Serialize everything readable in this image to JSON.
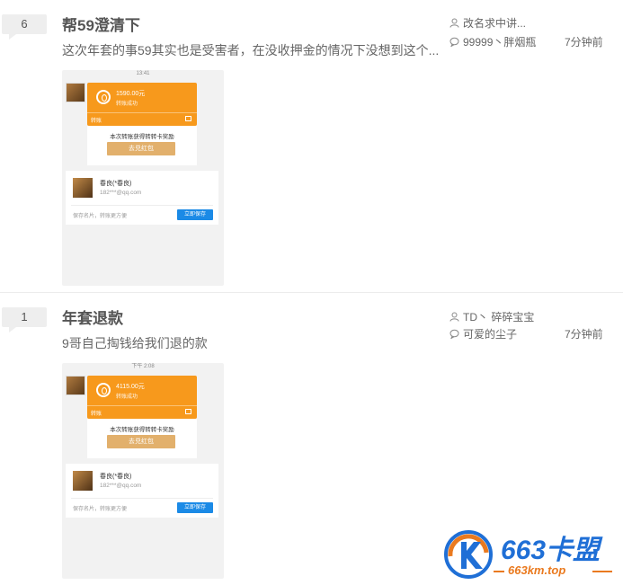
{
  "posts": [
    {
      "reply_count": "6",
      "title": "帮59澄清下",
      "excerpt": "这次年套的事59其实也是受害者，在没收押金的情况下没想到这个...",
      "author": "改名求中讲...",
      "last_reply": "99999丶胖烟瓶",
      "time": "7分钟前",
      "thumb": {
        "status_time": "13:41",
        "amount": "1590.00元",
        "received": "转账成功",
        "card_foot": "转账",
        "promo_text": "本次转账获得转转卡奖励",
        "promo_button": "去兑红包",
        "contact_name": "春良(*春良)",
        "contact_qq": "182***@qq.com",
        "contact_tip": "保存名片，转账更方便",
        "save_button": "立即保存"
      }
    },
    {
      "reply_count": "1",
      "title": "年套退款",
      "excerpt": "9哥自己掏钱给我们退的款",
      "author": "TD丶 碎碎宝宝",
      "last_reply": "可爱的尘子",
      "time": "7分钟前",
      "thumb": {
        "status_time": "下午 2:08",
        "amount": "4115.00元",
        "received": "转账成功",
        "card_foot": "转账",
        "promo_text": "本次转账获得转转卡奖励",
        "promo_button": "去兑红包",
        "contact_name": "春良(*春良)",
        "contact_qq": "182***@qq.com",
        "contact_tip": "保存名片，转账更方便",
        "save_button": "立即保存"
      }
    }
  ],
  "watermark": {
    "brand": "663卡盟",
    "url": "663km.top"
  },
  "colors": {
    "transfer_orange": "#f7991c",
    "promo_gold": "#e2b06c",
    "save_blue": "#1b8ae6",
    "watermark_blue": "#1f6fd6",
    "watermark_orange": "#ea7a1f"
  },
  "icons": {
    "author": "user-icon",
    "reply": "comment-icon"
  }
}
